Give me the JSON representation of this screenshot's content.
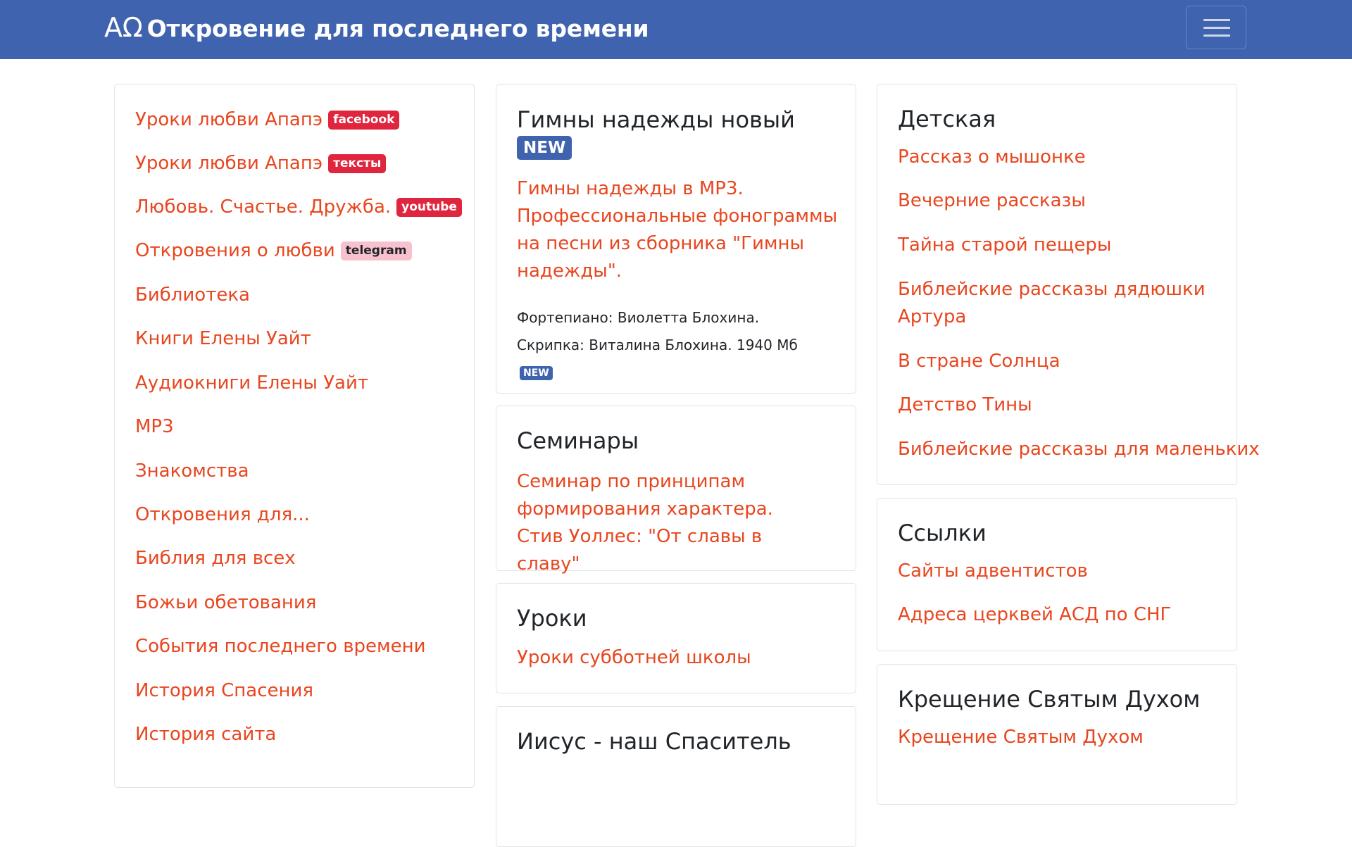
{
  "header": {
    "logo_symbol": "ΑΩ",
    "title": "Откровение для последнего времени",
    "menu_icon": "hamburger-icon"
  },
  "left_menu": {
    "items": [
      {
        "label": "Уроки любви Апапэ",
        "badge": "facebook"
      },
      {
        "label": "Уроки любви Апапэ",
        "badge": "тексты"
      },
      {
        "label": "Любовь. Счастье. Дружба.",
        "badge": "youtube"
      },
      {
        "label": "Откровения о любви",
        "badge": "telegram"
      },
      {
        "label": "Библиотека"
      },
      {
        "label": "Книги Елены Уайт"
      },
      {
        "label": "Аудиокниги Елены Уайт"
      },
      {
        "label": "MP3"
      },
      {
        "label": "Знакомства"
      },
      {
        "label": "Откровения для..."
      },
      {
        "label": "Библия для всех"
      },
      {
        "label": "Божьи обетования"
      },
      {
        "label": "События последнего времени"
      },
      {
        "label": "История Спасения"
      },
      {
        "label": "История сайта"
      }
    ]
  },
  "hymns_card": {
    "title": "Гимны надежды новый",
    "title_badge": "NEW",
    "link": "Гимны надежды в MP3. Профессиональные фонограммы на песни из сборника \"Гимны надежды\".",
    "meta": "Фортепиано: Виолетта Блохина. Скрипка: Виталина Блохина. 1940 Мб",
    "meta_badge": "NEW"
  },
  "seminars_card": {
    "title": "Семинары",
    "link": "Семинар по принципам формирования характера. Стив Уоллес: \"От славы в славу\""
  },
  "lessons_card": {
    "title": "Уроки",
    "link": "Уроки субботней школы"
  },
  "jesus_card": {
    "title": "Иисус - наш Спаситель"
  },
  "kids_card": {
    "title": "Детская",
    "links": [
      "Рассказ о мышонке",
      "Вечерние рассказы",
      "Тайна старой пещеры",
      "Библейские рассказы дядюшки Артура",
      "В стране Солнца",
      "Детство Тины",
      "Библейские рассказы для маленьких"
    ]
  },
  "links_card": {
    "title": "Ссылки",
    "links": [
      "Сайты адвентистов",
      "Адреса церквей АСД по СНГ"
    ]
  },
  "baptism_card": {
    "title": "Крещение Святым Духом",
    "links": [
      "Крещение Святым Духом"
    ]
  },
  "colors": {
    "navbar": "#3f63af",
    "link": "#e8461f",
    "badge_red": "#e0253e",
    "badge_pink": "#f7c2cd",
    "badge_new": "#3f63af"
  }
}
